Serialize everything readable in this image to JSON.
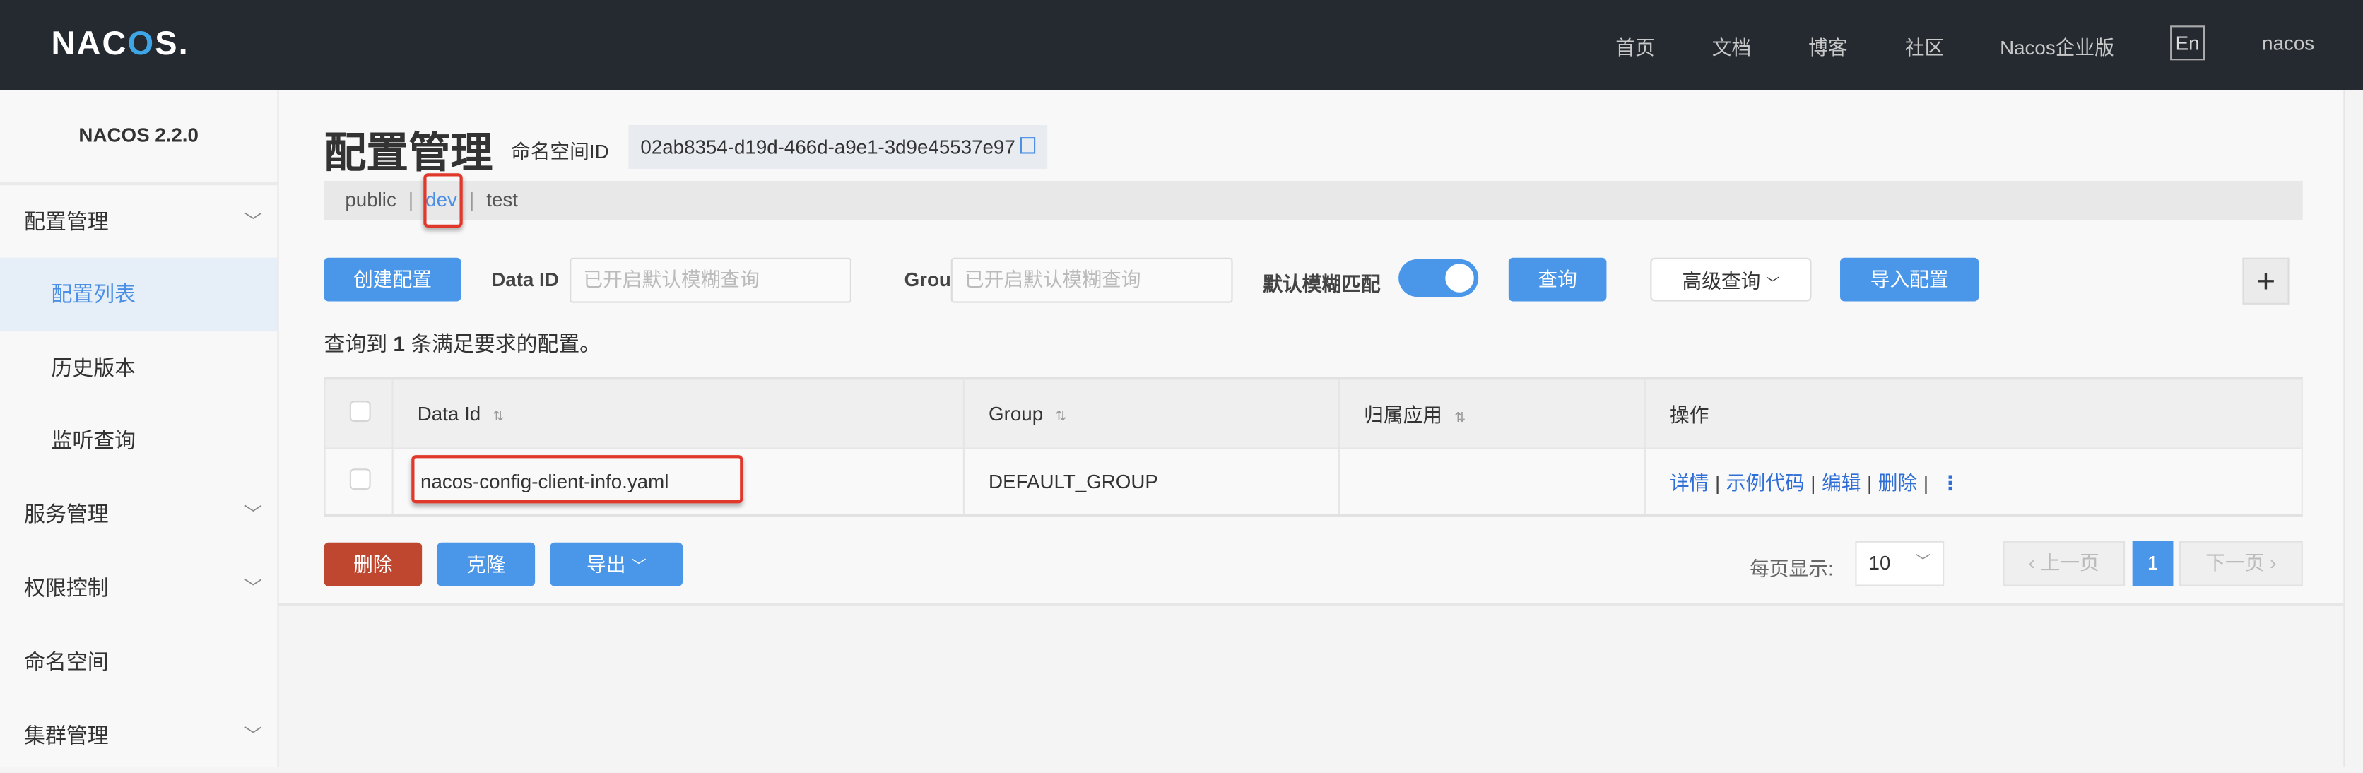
{
  "header": {
    "logo": "NACOS.",
    "nav": [
      "首页",
      "文档",
      "博客",
      "社区",
      "Nacos企业版"
    ],
    "lang": "En",
    "user": "nacos"
  },
  "sidebar": {
    "version": "NACOS 2.2.0",
    "items": [
      {
        "label": "配置管理",
        "expandable": true
      },
      {
        "label": "配置列表",
        "active": true
      },
      {
        "label": "历史版本"
      },
      {
        "label": "监听查询"
      },
      {
        "label": "服务管理",
        "expandable": true
      },
      {
        "label": "权限控制",
        "expandable": true
      },
      {
        "label": "命名空间"
      },
      {
        "label": "集群管理",
        "expandable": true
      }
    ]
  },
  "main": {
    "title": "配置管理",
    "namespace_label": "命名空间ID",
    "namespace_id": "02ab8354-d19d-466d-a9e1-3d9e45537e97",
    "namespaces": [
      "public",
      "dev",
      "test"
    ],
    "active_namespace": "dev",
    "toolbar": {
      "create": "创建配置",
      "data_id_label": "Data ID",
      "data_id_placeholder": "已开启默认模糊查询",
      "group_label": "Group",
      "group_placeholder": "已开启默认模糊查询",
      "fuzzy_label": "默认模糊匹配",
      "fuzzy_on": true,
      "query": "查询",
      "advanced": "高级查询",
      "import": "导入配置",
      "add": "+"
    },
    "result_prefix": "查询到 ",
    "result_count": "1",
    "result_suffix": " 条满足要求的配置。",
    "table": {
      "headers": [
        "Data Id",
        "Group",
        "归属应用",
        "操作"
      ],
      "rows": [
        {
          "data_id": "nacos-config-client-info.yaml",
          "group": "DEFAULT_GROUP",
          "app": "",
          "actions": [
            "详情",
            "示例代码",
            "编辑",
            "删除"
          ]
        }
      ]
    },
    "bottom": {
      "delete": "删除",
      "clone": "克隆",
      "export": "导出",
      "page_size_label": "每页显示:",
      "page_size": "10",
      "prev": "上一页",
      "page": "1",
      "next": "下一页"
    }
  },
  "colors": {
    "accent": "#4a97ea",
    "header_bg": "#252a31",
    "danger": "#c0472f",
    "highlight": "#e0382b"
  }
}
